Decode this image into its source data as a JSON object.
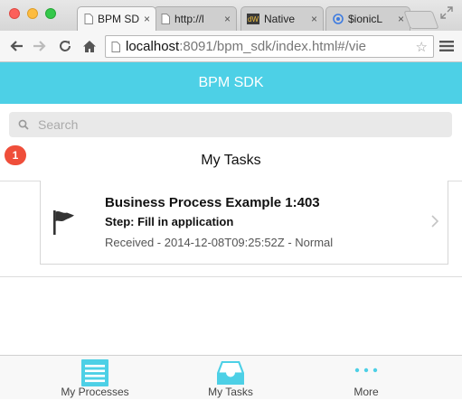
{
  "browser": {
    "tabs": [
      {
        "title": "BPM SD",
        "close": "×"
      },
      {
        "title": "http://l",
        "close": "×"
      },
      {
        "title": "Native",
        "close": "×"
      },
      {
        "title": "$ionicL",
        "close": "×"
      }
    ],
    "address": {
      "host": "localhost",
      "rest": ":8091/bpm_sdk/index.html#/vie"
    }
  },
  "app": {
    "header_title": "BPM SDK",
    "search_placeholder": "Search",
    "badge_count": "1",
    "section_title": "My Tasks",
    "tasks": [
      {
        "title": "Business Process Example 1:403",
        "step": "Step: Fill in application",
        "meta": "Received - 2014-12-08T09:25:52Z - Normal"
      }
    ]
  },
  "tabbar": {
    "items": [
      {
        "label": "My Processes",
        "icon": "list-icon"
      },
      {
        "label": "My Tasks",
        "icon": "inbox-icon"
      },
      {
        "label": "More",
        "icon": "more-dots-icon"
      }
    ]
  },
  "colors": {
    "accent": "#4dd0e6",
    "badge": "#ef4e3a"
  }
}
